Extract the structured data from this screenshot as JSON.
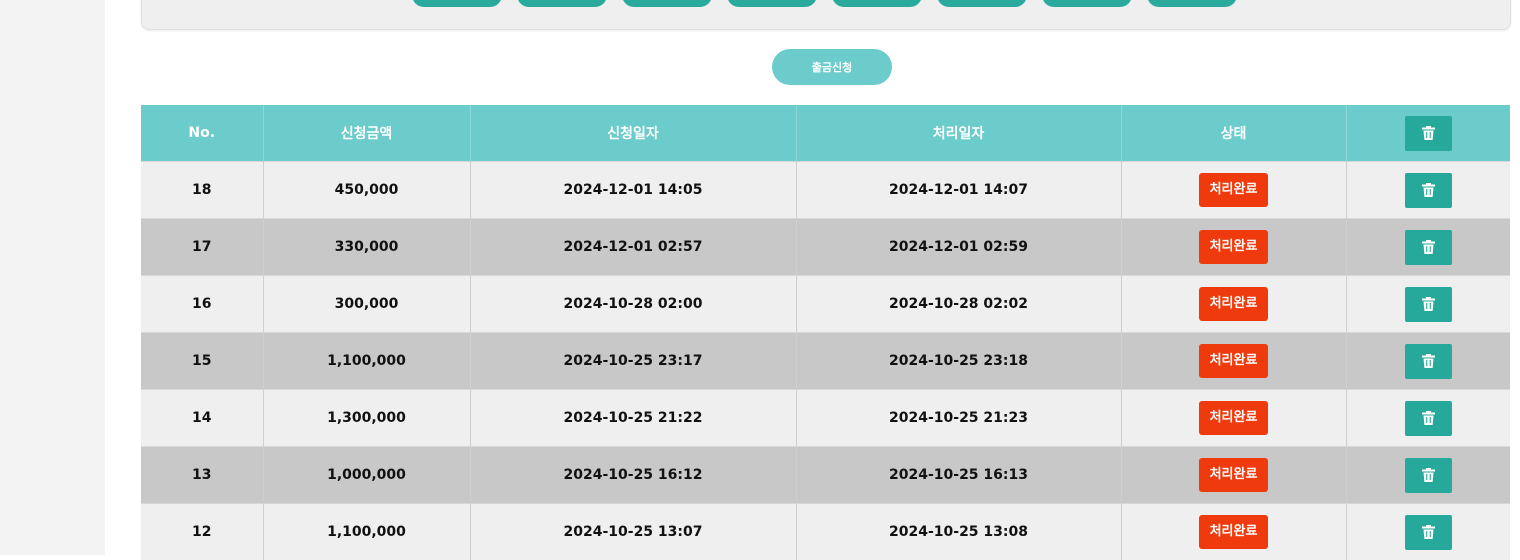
{
  "withdraw_button": {
    "label": "출금신청"
  },
  "table": {
    "headers": {
      "no": "No.",
      "amount": "신청금액",
      "request_date": "신청일자",
      "process_date": "처리일자",
      "status": "상태"
    },
    "rows": [
      {
        "no": "18",
        "amount": "450,000",
        "request_date": "2024-12-01 14:05",
        "process_date": "2024-12-01 14:07",
        "status": "처리완료"
      },
      {
        "no": "17",
        "amount": "330,000",
        "request_date": "2024-12-01 02:57",
        "process_date": "2024-12-01 02:59",
        "status": "처리완료"
      },
      {
        "no": "16",
        "amount": "300,000",
        "request_date": "2024-10-28 02:00",
        "process_date": "2024-10-28 02:02",
        "status": "처리완료"
      },
      {
        "no": "15",
        "amount": "1,100,000",
        "request_date": "2024-10-25 23:17",
        "process_date": "2024-10-25 23:18",
        "status": "처리완료"
      },
      {
        "no": "14",
        "amount": "1,300,000",
        "request_date": "2024-10-25 21:22",
        "process_date": "2024-10-25 21:23",
        "status": "처리완료"
      },
      {
        "no": "13",
        "amount": "1,000,000",
        "request_date": "2024-10-25 16:12",
        "process_date": "2024-10-25 16:13",
        "status": "처리완료"
      },
      {
        "no": "12",
        "amount": "1,100,000",
        "request_date": "2024-10-25 13:07",
        "process_date": "2024-10-25 13:08",
        "status": "처리완료"
      }
    ]
  },
  "icons": {
    "delete": "trash-icon"
  },
  "colors": {
    "header_teal": "#6ccbcb",
    "delete_button": "#26a99a",
    "status_red": "#ee3a0c"
  }
}
